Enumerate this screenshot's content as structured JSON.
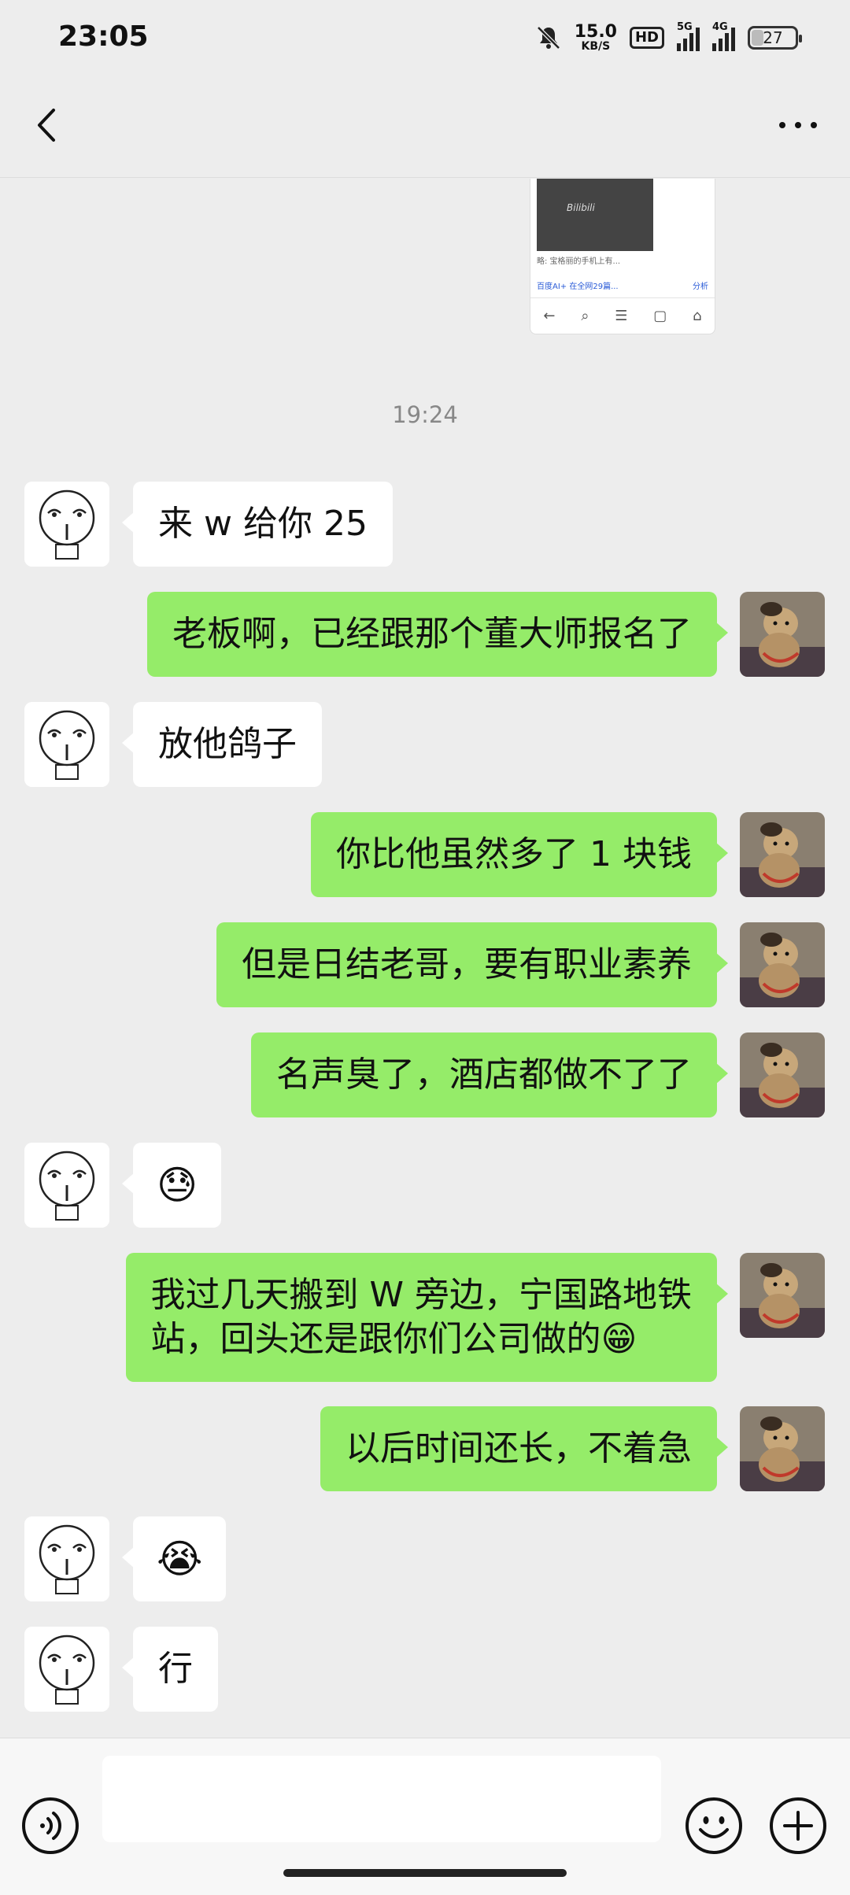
{
  "status_bar": {
    "time": "23:05",
    "net_speed_value": "15.0",
    "net_speed_unit": "KB/S",
    "hd_label": "HD",
    "sig1_label": "5G",
    "sig2_label": "4G",
    "battery": "27",
    "battery_level_percent": 27
  },
  "nav": {
    "back_icon": "chevron-left-icon",
    "more_icon": "ellipsis-icon"
  },
  "shared_image": {
    "video_title": "Bilibili",
    "caption": "略: 宝格丽的手机上有...",
    "ai_label": "百度AI+ 在全网29篇...",
    "ai_action": "分析",
    "nav_icons": [
      "←",
      "⌕",
      "☰",
      "▢",
      "⌂"
    ]
  },
  "timestamp": "19:24",
  "messages": [
    {
      "side": "left",
      "text": "来 w 给你 25"
    },
    {
      "side": "right",
      "text": "老板啊，已经跟那个董大师报名了"
    },
    {
      "side": "left",
      "text": "放他鸽子"
    },
    {
      "side": "right",
      "text": "你比他虽然多了 1 块钱"
    },
    {
      "side": "right",
      "text": "但是日结老哥，要有职业素养"
    },
    {
      "side": "right",
      "text": "名声臭了，酒店都做不了了"
    },
    {
      "side": "left",
      "text": "😓"
    },
    {
      "side": "right",
      "text": "我过几天搬到 W 旁边，宁国路地铁\n站，回头还是跟你们公司做的😁"
    },
    {
      "side": "right",
      "text": "以后时间还长，不着急"
    },
    {
      "side": "left",
      "text": "😭"
    },
    {
      "side": "left",
      "text": "行"
    }
  ],
  "input_bar": {
    "placeholder": "",
    "voice_icon": "voice-icon",
    "emoji_icon": "emoji-icon",
    "plus_icon": "plus-icon"
  },
  "colors": {
    "background": "#ededed",
    "sent_bubble": "#95ec69",
    "received_bubble": "#ffffff"
  }
}
